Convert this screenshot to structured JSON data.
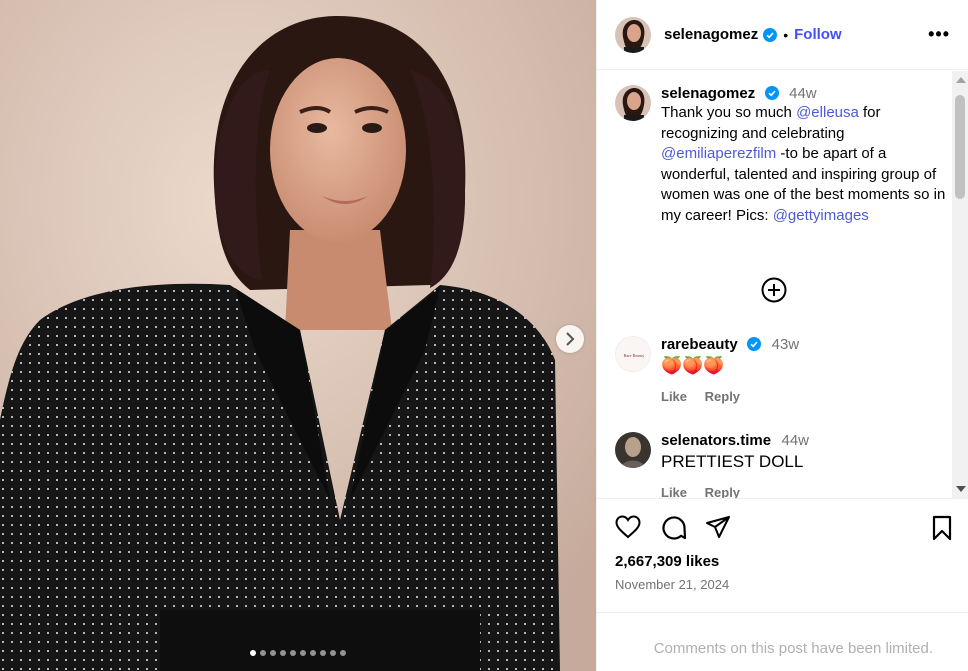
{
  "post": {
    "username": "selenagomez",
    "follow_label": "Follow",
    "separator": "•",
    "more_label": "•••"
  },
  "caption": {
    "username": "selenagomez",
    "time": "44w",
    "text_parts": {
      "p1": "Thank you so much ",
      "m1": "@elleusa",
      "p2": " for recognizing and celebrating ",
      "m2": "@emiliaperezfilm",
      "p3": " -to be apart of a wonderful, talented and inspiring group of women was one of the best moments so in my career! Pics: ",
      "m3": "@gettyimages"
    }
  },
  "comments": [
    {
      "username": "rarebeauty",
      "avatar_text": "Rare Beauty",
      "time": "43w",
      "text": "🍑🍑🍑",
      "like_label": "Like",
      "reply_label": "Reply"
    },
    {
      "username": "selenators.time",
      "time": "44w",
      "text": "PRETTIEST DOLL",
      "like_label": "Like",
      "reply_label": "Reply"
    }
  ],
  "stats": {
    "likes": "2,667,309 likes",
    "date": "November 21, 2024"
  },
  "limited_notice": "Comments on this post have been limited.",
  "carousel": {
    "total": 10,
    "active_index": 0
  },
  "icons": {
    "verified": "verified-badge-icon",
    "next": "chevron-right-icon",
    "load_more": "plus-circle-icon",
    "like": "heart-icon",
    "comment": "comment-icon",
    "share": "paper-plane-icon",
    "save": "bookmark-icon"
  },
  "colors": {
    "verified": "#0095f6",
    "link": "#4d5ad8",
    "muted": "#737373"
  }
}
